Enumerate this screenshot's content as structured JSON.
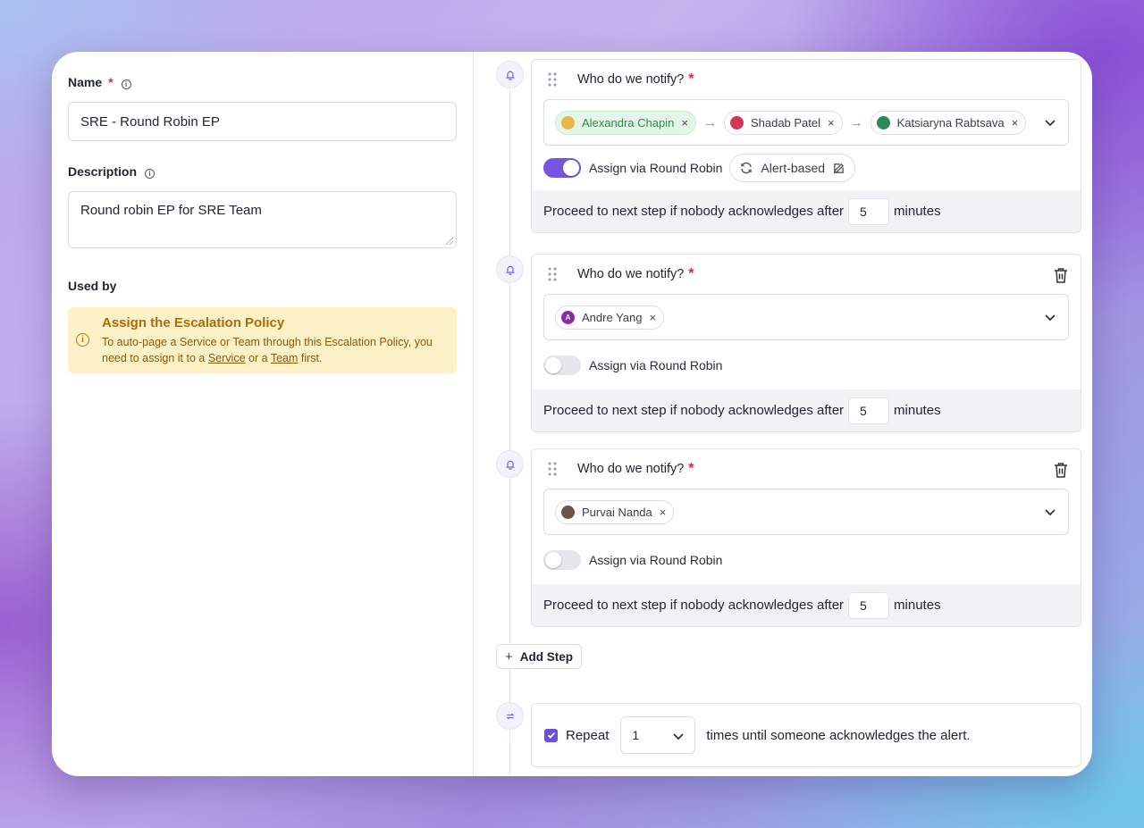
{
  "left": {
    "name_label": "Name",
    "name_required": "*",
    "name_value": "SRE - Round Robin EP",
    "description_label": "Description",
    "description_value": "Round robin EP for SRE Team",
    "used_by_label": "Used by",
    "notice": {
      "title": "Assign the Escalation Policy",
      "body_prefix": "To auto-page a Service or Team through this Escalation Policy, you need to assign it to a",
      "link_service": "Service",
      "body_or": "or a",
      "link_team": "Team",
      "body_suffix": "first."
    }
  },
  "steps": [
    {
      "question": "Who do we notify?",
      "required": "*",
      "recipients": [
        {
          "name": "Alexandra Chapin",
          "remove": "×"
        },
        {
          "name": "Shadab Patel",
          "remove": "×"
        },
        {
          "name": "Katsiaryna Rabtsava",
          "remove": "×"
        }
      ],
      "round_robin_label": "Assign via Round Robin",
      "round_robin_on": true,
      "round_robin_mode": "Alert-based",
      "proceed_text": "Proceed to next step if nobody acknowledges after",
      "minutes_value": "5",
      "minutes_label": "minutes"
    },
    {
      "question": "Who do we notify?",
      "required": "*",
      "recipients": [
        {
          "name": "Andre Yang",
          "initial": "A",
          "remove": "×"
        }
      ],
      "round_robin_label": "Assign via Round Robin",
      "round_robin_on": false,
      "proceed_text": "Proceed to next step if nobody acknowledges after",
      "minutes_value": "5",
      "minutes_label": "minutes"
    },
    {
      "question": "Who do we notify?",
      "required": "*",
      "recipients": [
        {
          "name": "Purvai Nanda",
          "remove": "×"
        }
      ],
      "round_robin_label": "Assign via Round Robin",
      "round_robin_on": false,
      "proceed_text": "Proceed to next step if nobody acknowledges after",
      "minutes_value": "5",
      "minutes_label": "minutes"
    }
  ],
  "add_step_label": "Add Step",
  "repeat": {
    "checked": true,
    "label": "Repeat",
    "times_value": "1",
    "suffix": "times until someone acknowledges the alert."
  },
  "colors": {
    "accent": "#7656e0",
    "notice_bg": "#fdf1c7",
    "notice_title": "#a86c0c",
    "required": "#e0283a",
    "chip_green_bg": "#e4f5e9"
  }
}
